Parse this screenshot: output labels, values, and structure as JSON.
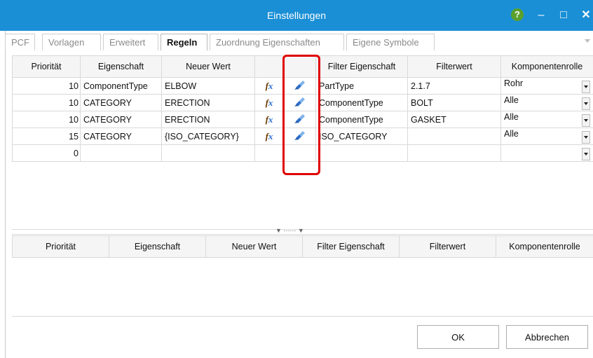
{
  "window": {
    "title": "Einstellungen",
    "help_label": "?"
  },
  "tabs": [
    "PCF",
    "Vorlagen",
    "Erweitert",
    "Regeln",
    "Zuordnung Eigenschaften",
    "Eigene Symbole"
  ],
  "active_tab": "Regeln",
  "top_table": {
    "columns": [
      "Priorität",
      "Eigenschaft",
      "Neuer Wert",
      "",
      "",
      "Filter Eigenschaft",
      "Filterwert",
      "Komponentenrolle"
    ],
    "rows": [
      {
        "priority": "10",
        "property": "ComponentType",
        "new_value": "ELBOW",
        "filter_property": "PartType",
        "filter_value": "2.1.7",
        "role": "Rohr"
      },
      {
        "priority": "10",
        "property": "CATEGORY",
        "new_value": "ERECTION",
        "filter_property": "ComponentType",
        "filter_value": "BOLT",
        "role": "Alle"
      },
      {
        "priority": "10",
        "property": "CATEGORY",
        "new_value": "ERECTION",
        "filter_property": "ComponentType",
        "filter_value": "GASKET",
        "role": "Alle"
      },
      {
        "priority": "15",
        "property": "CATEGORY",
        "new_value": "{ISO_CATEGORY}",
        "filter_property": "ISO_CATEGORY",
        "filter_value": "",
        "role": "Alle"
      },
      {
        "priority": "0",
        "property": "",
        "new_value": "",
        "filter_property": "",
        "filter_value": "",
        "role": ""
      }
    ]
  },
  "bottom_table": {
    "columns": [
      "Priorität",
      "Eigenschaft",
      "Neuer Wert",
      "Filter Eigenschaft",
      "Filterwert",
      "Komponentenrolle"
    ]
  },
  "buttons": {
    "ok": "OK",
    "cancel": "Abbrechen"
  },
  "colors": {
    "titlebar": "#1a8fd6",
    "highlight": "#e00000"
  },
  "icons": {
    "formula": "fx-formula-icon",
    "filter": "paint-brush-icon"
  }
}
